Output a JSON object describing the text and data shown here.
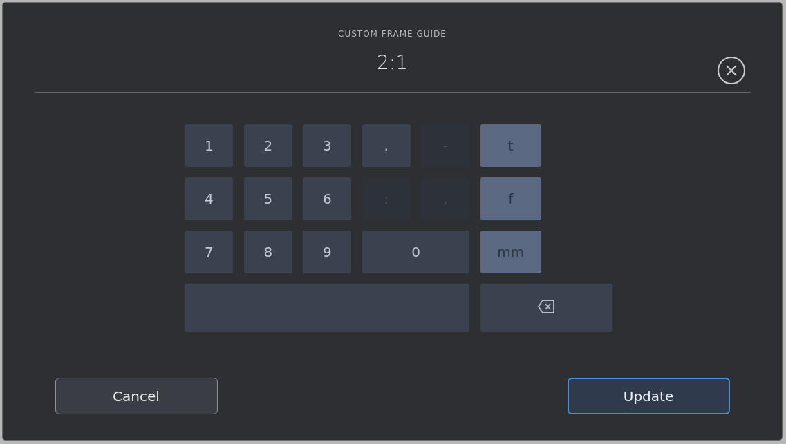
{
  "dialog": {
    "title": "CUSTOM FRAME GUIDE",
    "value": "2:1"
  },
  "keypad": [
    {
      "kind": "digit",
      "label": "1",
      "disabled": false
    },
    {
      "kind": "digit",
      "label": "2",
      "disabled": false
    },
    {
      "kind": "digit",
      "label": "3",
      "disabled": false
    },
    {
      "kind": "digit",
      "label": ".",
      "disabled": false
    },
    {
      "kind": "digit",
      "label": "-",
      "disabled": true
    },
    {
      "kind": "unit",
      "label": "t",
      "disabled": false
    },
    {
      "kind": "digit",
      "label": "4",
      "disabled": false
    },
    {
      "kind": "digit",
      "label": "5",
      "disabled": false
    },
    {
      "kind": "digit",
      "label": "6",
      "disabled": false
    },
    {
      "kind": "digit",
      "label": ":",
      "disabled": true
    },
    {
      "kind": "digit",
      "label": ",",
      "disabled": true
    },
    {
      "kind": "unit",
      "label": "f",
      "disabled": false
    },
    {
      "kind": "digit",
      "label": "7",
      "disabled": false
    },
    {
      "kind": "digit",
      "label": "8",
      "disabled": false
    },
    {
      "kind": "digit",
      "label": "9",
      "disabled": false
    },
    {
      "kind": "wide",
      "label": "0",
      "disabled": false
    },
    {
      "kind": "unit",
      "label": "mm",
      "disabled": false
    },
    {
      "kind": "space",
      "disabled": false
    },
    {
      "kind": "backspace",
      "disabled": false
    }
  ],
  "buttons": [
    {
      "label": "Cancel",
      "selected": false
    },
    {
      "label": "Update",
      "selected": true
    }
  ]
}
